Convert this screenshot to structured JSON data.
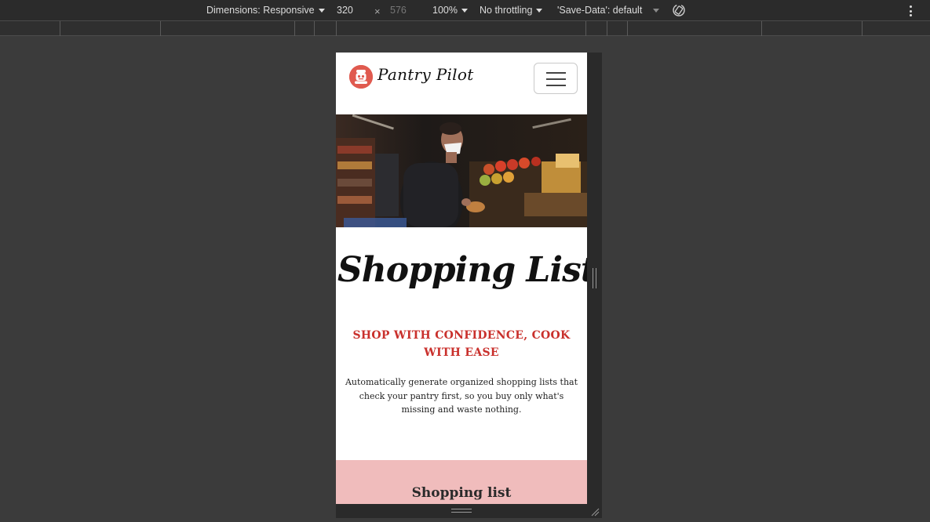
{
  "devtools": {
    "dimensions_label": "Dimensions: Responsive",
    "width": "320",
    "times": "×",
    "height": "576",
    "zoom": "100%",
    "throttling": "No throttling",
    "save_data": "'Save-Data': default",
    "rotate_icon": "rotate-icon",
    "menu_icon": "more-options-icon"
  },
  "site": {
    "brand": "Pantry Pilot",
    "logo_icon": "robot-chef-icon",
    "menu_icon": "hamburger-icon",
    "hero_alt": "Man in face mask shopping for produce in a grocery store",
    "title": "Shopping Lists",
    "subtitle": "SHOP WITH CONFIDENCE, COOK WITH EASE",
    "lead": "Automatically generate organized shopping lists that check your pantry first, so you buy only what's missing and waste nothing.",
    "section_title": "Shopping list",
    "colors": {
      "accent": "#c9302c",
      "section_bg": "#f0bcbc",
      "logo_bg": "#e05a4f"
    }
  }
}
